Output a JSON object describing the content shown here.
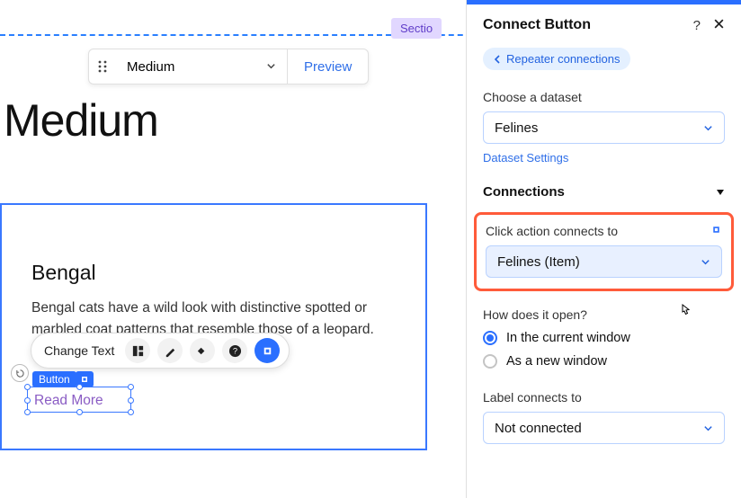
{
  "section_label": "Sectio",
  "toolbar": {
    "breakpoint": "Medium",
    "preview": "Preview"
  },
  "page_title": "Medium",
  "repeater": {
    "title": "Bengal",
    "description": "Bengal cats have a wild look with distinctive spotted or marbled coat patterns that resemble those of a leopard."
  },
  "edit_bar": {
    "change_text": "Change Text"
  },
  "selected_badge": "Button",
  "read_more": "Read More",
  "panel": {
    "title": "Connect Button",
    "back": "Repeater connections",
    "choose_dataset_label": "Choose a dataset",
    "dataset_value": "Felines",
    "dataset_settings": "Dataset Settings",
    "connections_header": "Connections",
    "click_action_label": "Click action connects to",
    "click_action_value": "Felines (Item)",
    "how_open_label": "How does it open?",
    "open_current": "In the current window",
    "open_new": "As a new window",
    "label_connects_label": "Label connects to",
    "label_connects_value": "Not connected"
  }
}
